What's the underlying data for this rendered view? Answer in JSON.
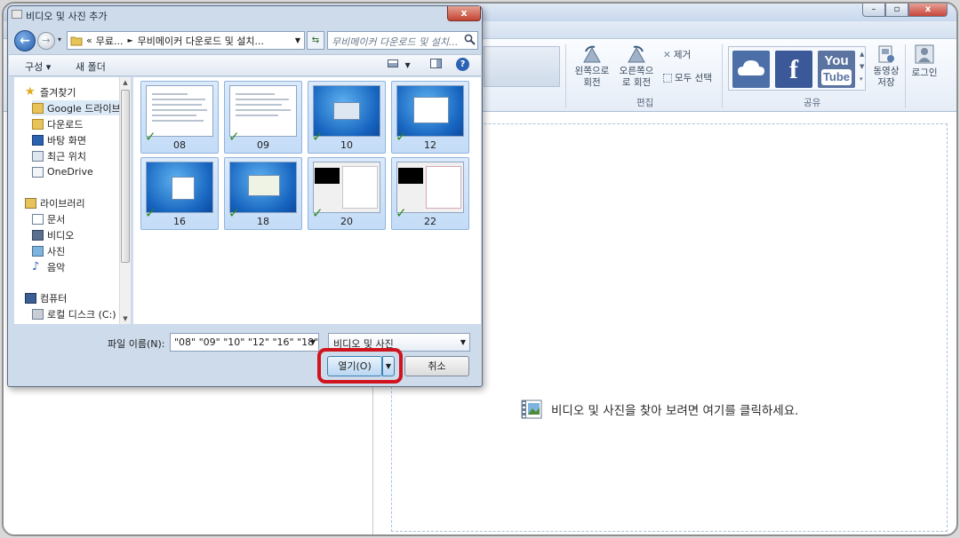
{
  "movie_maker": {
    "ribbon": {
      "rotate_left": "왼쪽으로 회전",
      "rotate_right": "오른쪽으로 회전",
      "remove": "제거",
      "select_all": "모두 선택",
      "edit_group": "편집",
      "share_group": "공유",
      "save_movie": "동영상 저장",
      "sign_in": "로그인",
      "youtube_you": "You",
      "youtube_tube": "Tube",
      "facebook_f": "f"
    },
    "storyboard_placeholder": "비디오 및 사진을 찾아 보려면 여기를 클릭하세요."
  },
  "dialog": {
    "title": "비디오 및 사진 추가",
    "address_prefix": "«",
    "address_parts": [
      "무료...",
      "무비메이커 다운로드 및 설치..."
    ],
    "search_placeholder": "무비메이커 다운로드 및 설치...",
    "toolbar": {
      "organize": "구성 ▾",
      "new_folder": "새 폴더"
    },
    "nav": {
      "favorites": "즐겨찾기",
      "favorites_items": [
        "Google 드라이브",
        "다운로드",
        "바탕 화면",
        "최근 위치",
        "OneDrive"
      ],
      "libraries": "라이브러리",
      "libraries_items": [
        "문서",
        "비디오",
        "사진",
        "음악"
      ],
      "computer": "컴퓨터",
      "computer_items": [
        "로컬 디스크 (C:)"
      ]
    },
    "files": [
      {
        "name": "08",
        "thumb": "doc"
      },
      {
        "name": "09",
        "thumb": "doc"
      },
      {
        "name": "10",
        "thumb": "win7"
      },
      {
        "name": "12",
        "thumb": "win7"
      },
      {
        "name": "16",
        "thumb": "win7"
      },
      {
        "name": "18",
        "thumb": "win7"
      },
      {
        "name": "20",
        "thumb": "dlg"
      },
      {
        "name": "22",
        "thumb": "dlg"
      }
    ],
    "file_name_label": "파일 이름(N):",
    "file_name_value": "\"08\" \"09\" \"10\" \"12\" \"16\" \"18\" \"2",
    "file_type_value": "비디오 및 사진",
    "open_button": "열기(O)",
    "cancel_button": "취소",
    "close_glyph": "x",
    "back_glyph": "←",
    "forward_glyph": "→"
  },
  "colors": {
    "highlight": "#d0141e",
    "selection": "#c4dcf7",
    "check": "#2f8a1f"
  }
}
